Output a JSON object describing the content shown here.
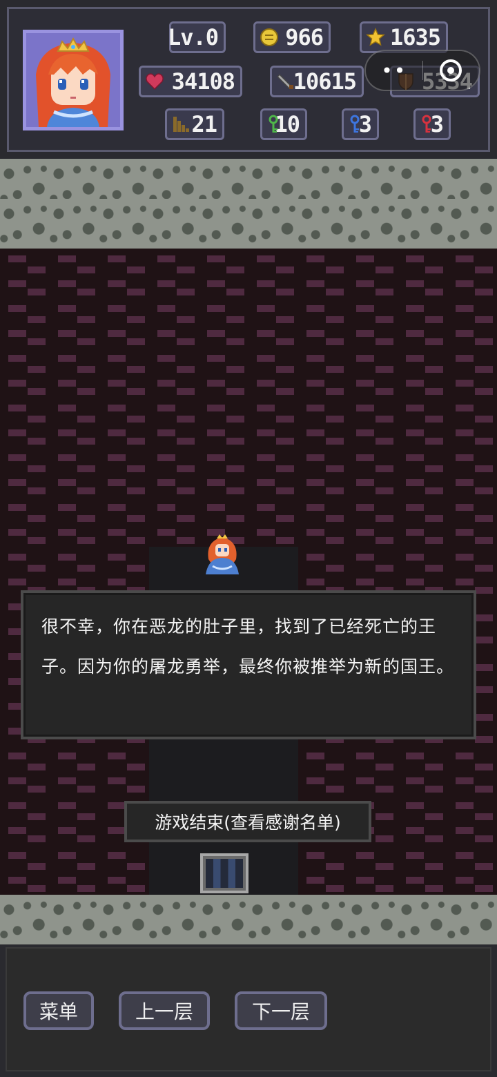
{
  "hero": {
    "level": "Lv.0",
    "gold": "966",
    "exp": "1635",
    "hp": "34108",
    "attack": "10615",
    "defense": "5334",
    "floor": "21",
    "green_keys": "10",
    "blue_keys": "3",
    "red_keys": "3"
  },
  "capsule": {
    "more_label": "••"
  },
  "story": {
    "text": "很不幸，你在恶龙的肚子里，找到了已经死亡的王子。因为你的屠龙勇举，最终你被推举为新的国王。",
    "button_label": "游戏结束(查看感谢名单)"
  },
  "nav": {
    "menu_label": "菜单",
    "prev_floor_label": "上一层",
    "next_floor_label": "下一层"
  },
  "colors": {
    "panel_bg": "#2d2d36",
    "stat_border": "#6e6e8e",
    "brick": "#4f2a40",
    "stone": "#8f948c",
    "portrait_bg": "#7b74c9"
  }
}
